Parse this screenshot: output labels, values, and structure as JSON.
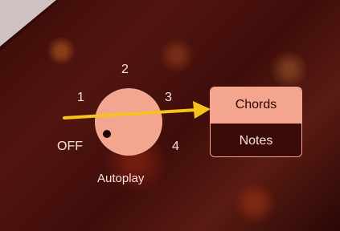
{
  "colors": {
    "accent": "#f4a58f",
    "background": "#4a120d",
    "text": "#f7e2d6",
    "dark_text": "#2a0605",
    "arrow": "#f6c21c"
  },
  "autoplay": {
    "label": "Autoplay",
    "dial_labels": {
      "off": "OFF",
      "one": "1",
      "two": "2",
      "three": "3",
      "four": "4"
    }
  },
  "mode_toggle": {
    "options": [
      {
        "label": "Chords",
        "selected": true
      },
      {
        "label": "Notes",
        "selected": false
      }
    ]
  },
  "annotation": {
    "arrow_icon": "annotation-arrow-icon"
  }
}
